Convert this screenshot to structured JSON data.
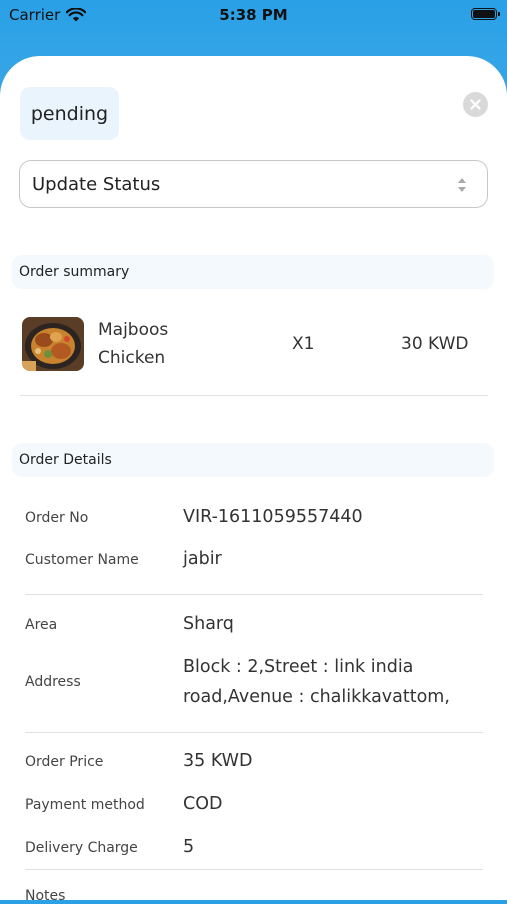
{
  "status_bar": {
    "carrier": "Carrier",
    "time": "5:38 PM",
    "battery_level": 1.0
  },
  "status_pill": {
    "label": "pending"
  },
  "update_status": {
    "label": "Update Status"
  },
  "order_summary": {
    "title": "Order summary",
    "items": [
      {
        "name": "Majboos Chicken",
        "qty": "X1",
        "price": "30 KWD"
      }
    ]
  },
  "order_details": {
    "title": "Order Details",
    "fields": {
      "order_no": {
        "label": "Order No",
        "value": "VIR-1611059557440"
      },
      "customer_name": {
        "label": "Customer Name",
        "value": "jabir"
      },
      "area": {
        "label": "Area",
        "value": "Sharq"
      },
      "address": {
        "label": "Address",
        "value": "Block : 2,Street : link india road,Avenue : chalikkavattom,"
      },
      "order_price": {
        "label": "Order Price",
        "value": "35 KWD"
      },
      "payment_method": {
        "label": "Payment method",
        "value": "COD"
      },
      "delivery_charge": {
        "label": "Delivery Charge",
        "value": "5"
      },
      "notes": {
        "label": "Notes"
      }
    }
  },
  "colors": {
    "accent_bg": "#e9f4fc",
    "section_bg": "#f3f9fd",
    "header_gradient_top": "#2aa0e6"
  },
  "icons": {
    "close": "close-circle-icon",
    "select": "up-down-chevron-icon",
    "wifi": "wifi-icon",
    "battery": "battery-icon"
  }
}
